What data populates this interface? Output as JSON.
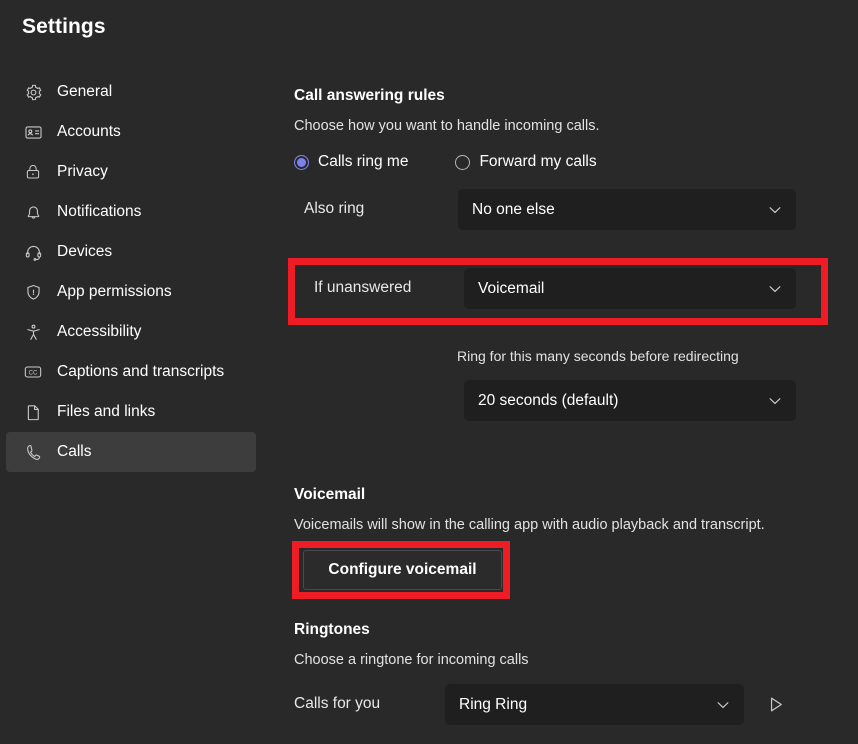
{
  "window": {
    "title": "Settings"
  },
  "sidebar": {
    "items": [
      {
        "label": "General",
        "icon": "gear-icon",
        "selected": false
      },
      {
        "label": "Accounts",
        "icon": "contact-card-icon",
        "selected": false
      },
      {
        "label": "Privacy",
        "icon": "lock-icon",
        "selected": false
      },
      {
        "label": "Notifications",
        "icon": "bell-icon",
        "selected": false
      },
      {
        "label": "Devices",
        "icon": "headset-icon",
        "selected": false
      },
      {
        "label": "App permissions",
        "icon": "shield-icon",
        "selected": false
      },
      {
        "label": "Accessibility",
        "icon": "accessibility-icon",
        "selected": false
      },
      {
        "label": "Captions and transcripts",
        "icon": "closed-caption-icon",
        "selected": false
      },
      {
        "label": "Files and links",
        "icon": "document-icon",
        "selected": false
      },
      {
        "label": "Calls",
        "icon": "phone-icon",
        "selected": true
      }
    ]
  },
  "main": {
    "call_answering_rules": {
      "heading": "Call answering rules",
      "description": "Choose how you want to handle incoming calls.",
      "radio_options": [
        {
          "label": "Calls ring me",
          "checked": true
        },
        {
          "label": "Forward my calls",
          "checked": false
        }
      ],
      "also_ring": {
        "label": "Also ring",
        "value": "No one else"
      },
      "if_unanswered": {
        "label": "If unanswered",
        "value": "Voicemail",
        "highlighted": true
      },
      "ring_seconds": {
        "helper": "Ring for this many seconds before redirecting",
        "value": "20 seconds (default)"
      }
    },
    "voicemail": {
      "heading": "Voicemail",
      "description": "Voicemails will show in the calling app with audio playback and transcript.",
      "configure_button": "Configure voicemail",
      "configure_highlighted": true
    },
    "ringtones": {
      "heading": "Ringtones",
      "description": "Choose a ringtone for incoming calls",
      "calls_for_you": {
        "label": "Calls for you",
        "value": "Ring Ring"
      },
      "preview_icon": "play-icon"
    }
  },
  "colors": {
    "background": "#292929",
    "selected_nav": "#3d3d3d",
    "dropdown_bg": "#1f1f1f",
    "accent_radio": "#7b83eb",
    "highlight_red": "#ee1c24",
    "text_primary": "#ffffff",
    "text_secondary": "#e2e2e2"
  }
}
